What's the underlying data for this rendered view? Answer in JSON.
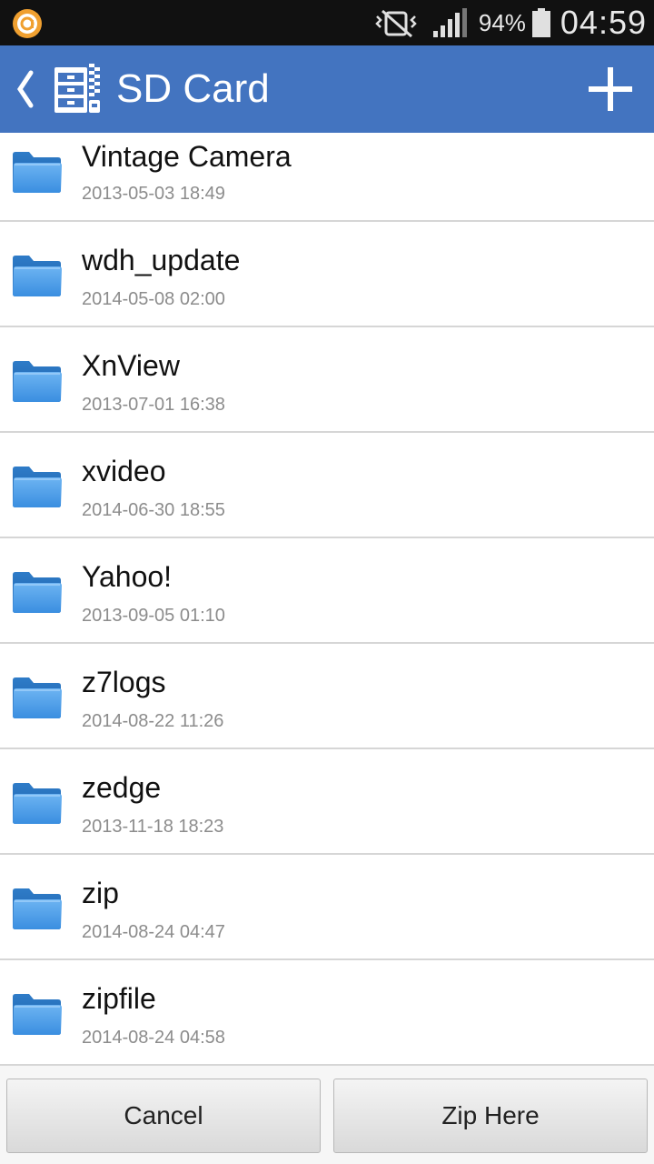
{
  "status_bar": {
    "battery_percent": "94%",
    "time": "04:59",
    "icons": [
      "app-notification-icon",
      "mute-vibrate-icon",
      "signal-icon",
      "battery-icon"
    ]
  },
  "header": {
    "title": "SD Card",
    "background_color": "#4374c0",
    "icons": [
      "back-chevron-icon",
      "zip-archive-logo-icon",
      "add-plus-icon"
    ]
  },
  "files": [
    {
      "name": "Vintage Camera",
      "date": "2013-05-03 18:49"
    },
    {
      "name": "wdh_update",
      "date": "2014-05-08 02:00"
    },
    {
      "name": "XnView",
      "date": "2013-07-01 16:38"
    },
    {
      "name": "xvideo",
      "date": "2014-06-30 18:55"
    },
    {
      "name": "Yahoo!",
      "date": "2013-09-05 01:10"
    },
    {
      "name": "z7logs",
      "date": "2014-08-22 11:26"
    },
    {
      "name": "zedge",
      "date": "2013-11-18 18:23"
    },
    {
      "name": "zip",
      "date": "2014-08-24 04:47"
    },
    {
      "name": "zipfile",
      "date": "2014-08-24 04:58"
    }
  ],
  "buttons": {
    "cancel": "Cancel",
    "zip_here": "Zip Here"
  }
}
